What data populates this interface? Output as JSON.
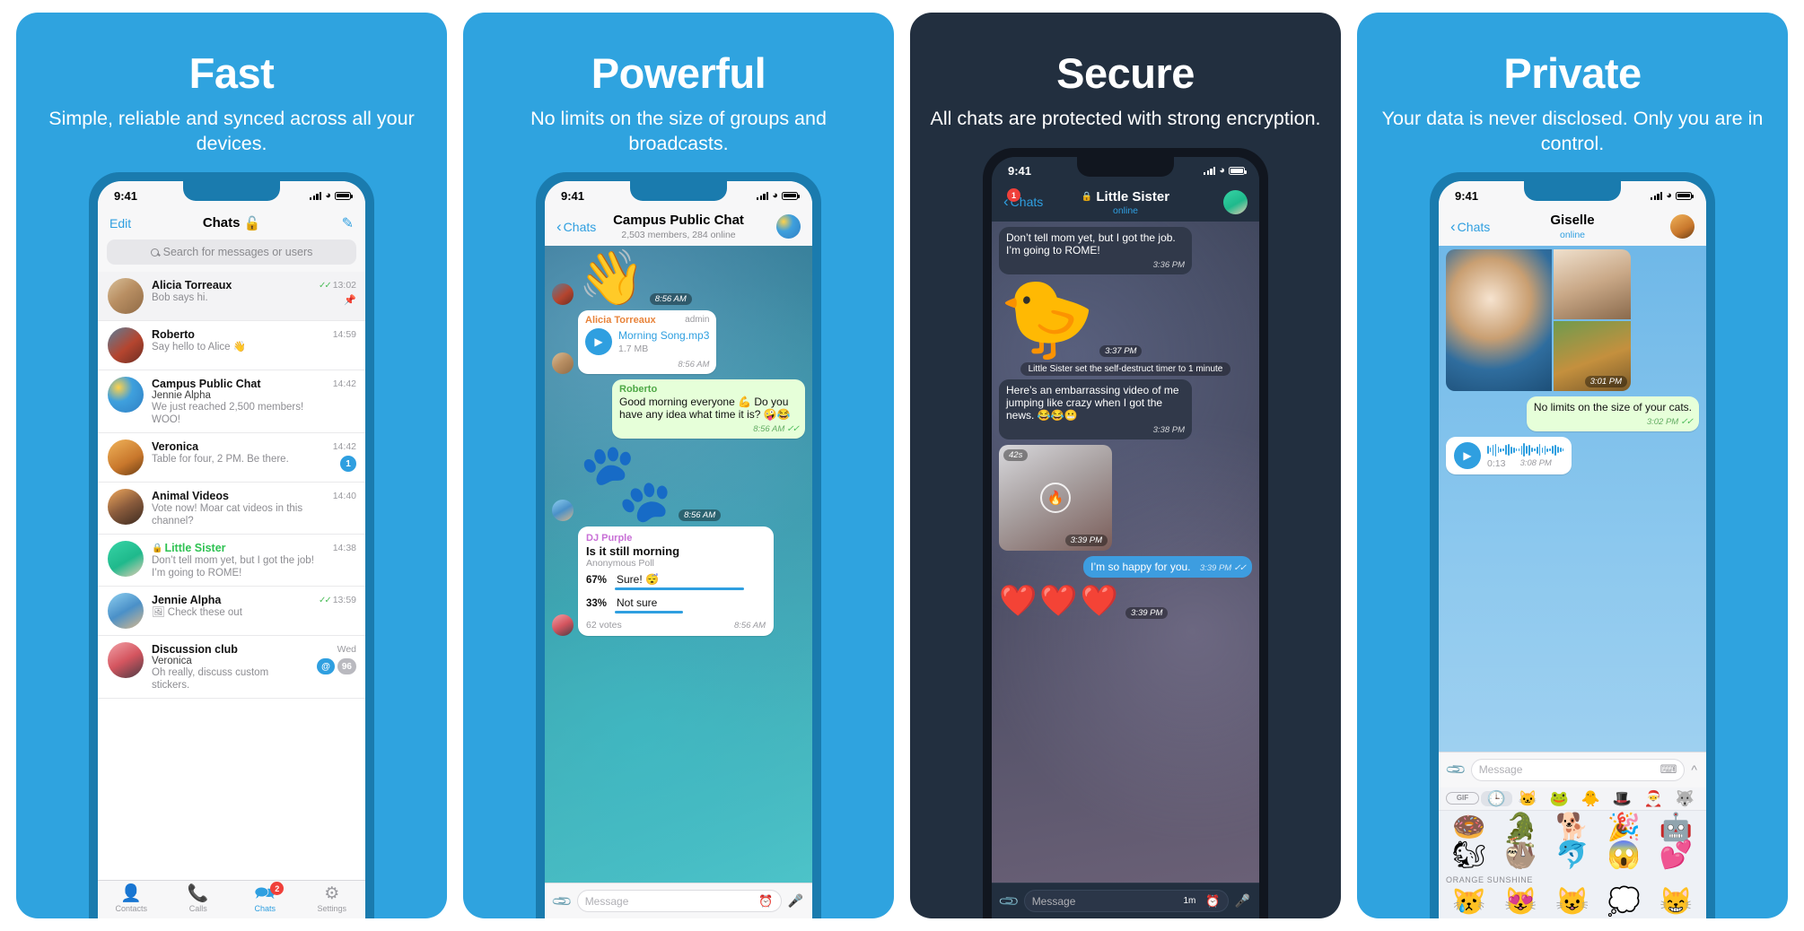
{
  "panels": [
    {
      "id": "fast",
      "headline": "Fast",
      "subhead": "Simple, reliable and synced across all your devices.",
      "status": {
        "time": "9:41"
      },
      "nav": {
        "left": "Edit",
        "title": "Chats",
        "lock_icon": "unlock-icon",
        "compose_icon": "compose-icon"
      },
      "search": {
        "placeholder": "Search for messages or users",
        "icon": "search-icon"
      },
      "chats": [
        {
          "name": "Alicia Torreaux",
          "sender": "",
          "message": "Bob says hi.",
          "time": "13:02",
          "ticks": "✓✓",
          "badge": "",
          "pin": "pin-icon",
          "secure": false,
          "unread": true
        },
        {
          "name": "Roberto",
          "sender": "",
          "message": "Say hello to Alice 👋",
          "time": "14:59",
          "ticks": "",
          "badge": "",
          "pin": "",
          "secure": false,
          "unread": false
        },
        {
          "name": "Campus Public Chat",
          "sender": "Jennie Alpha",
          "message": "We just reached 2,500 members! WOO!",
          "time": "14:42",
          "ticks": "",
          "badge": "",
          "pin": "",
          "secure": false,
          "unread": false
        },
        {
          "name": "Veronica",
          "sender": "",
          "message": "Table for four, 2 PM. Be there.",
          "time": "14:42",
          "ticks": "",
          "badge": "1",
          "pin": "",
          "secure": false,
          "unread": false
        },
        {
          "name": "Animal Videos",
          "sender": "",
          "message": "Vote now! Moar cat videos in this channel?",
          "time": "14:40",
          "ticks": "",
          "badge": "",
          "pin": "",
          "secure": false,
          "unread": false
        },
        {
          "name": "Little Sister",
          "sender": "",
          "message": "Don’t tell mom yet, but I got the job! I’m going to ROME!",
          "time": "14:38",
          "ticks": "",
          "badge": "",
          "pin": "",
          "secure": true,
          "unread": false
        },
        {
          "name": "Jennie Alpha",
          "sender": "",
          "message": "🖼 Check these out",
          "time": "13:59",
          "ticks": "✓✓",
          "badge": "",
          "pin": "",
          "secure": false,
          "unread": false
        },
        {
          "name": "Discussion club",
          "sender": "Veronica",
          "message": "Oh really, discuss custom stickers.",
          "time": "Wed",
          "ticks": "",
          "badge": "96",
          "mention": "@",
          "pin": "",
          "secure": false,
          "unread": false
        }
      ],
      "tabs": [
        {
          "label": "Contacts",
          "icon": "contacts-icon",
          "active": false,
          "badge": ""
        },
        {
          "label": "Calls",
          "icon": "phone-icon",
          "active": false,
          "badge": ""
        },
        {
          "label": "Chats",
          "icon": "chat-bubbles-icon",
          "active": true,
          "badge": "2"
        },
        {
          "label": "Settings",
          "icon": "gear-icon",
          "active": false,
          "badge": ""
        }
      ]
    },
    {
      "id": "powerful",
      "headline": "Powerful",
      "subhead": "No limits on the size of groups and broadcasts.",
      "status": {
        "time": "9:41"
      },
      "nav": {
        "left": "Chats",
        "title": "Campus Public Chat",
        "subtitle": "2,503 members, 284 online",
        "avatar": "group-avatar"
      },
      "messages": [
        {
          "kind": "sticker",
          "glyph": "👋",
          "time": "8:56 AM",
          "avatar": "ph2"
        },
        {
          "kind": "file",
          "sender": "Alicia Torreaux",
          "sender_color": "orange",
          "admin": "admin",
          "filename": "Morning Song.mp3",
          "filesize": "1.7 MB",
          "time": "8:56 AM",
          "avatar": "ph1"
        },
        {
          "kind": "text",
          "sender": "Roberto",
          "sender_color": "green",
          "text": "Good morning everyone 💪 Do you have any idea what time it is? 🤪😂",
          "time": "8:56 AM",
          "ticks": "✓✓",
          "out": true
        },
        {
          "kind": "sticker",
          "glyph": "🐾",
          "time": "8:56 AM",
          "avatar": "ph7"
        },
        {
          "kind": "poll",
          "sender": "DJ Purple",
          "sender_color": "purple",
          "question": "Is it still morning",
          "subtitle": "Anonymous Poll",
          "options": [
            {
              "pct": "67%",
              "label": "Sure! 😴",
              "value": 67
            },
            {
              "pct": "33%",
              "label": "Not sure",
              "value": 33
            }
          ],
          "votes": "62 votes",
          "time": "8:56 AM",
          "avatar": "ph8"
        }
      ],
      "composer": {
        "clip_icon": "attach-icon",
        "placeholder": "Message",
        "timer_icon": "schedule-icon",
        "mic_icon": "microphone-icon"
      }
    },
    {
      "id": "secure",
      "headline": "Secure",
      "subhead": "All chats are protected with strong encryption.",
      "status": {
        "time": "9:41"
      },
      "nav": {
        "left": "Chats",
        "left_badge": "1",
        "title": "Little Sister",
        "lock_icon": "lock-icon",
        "subtitle": "online",
        "avatar": "ph6"
      },
      "messages": [
        {
          "kind": "text",
          "text": "Don’t tell mom yet, but I got the job. I’m going to ROME!",
          "time": "3:36 PM",
          "out": false
        },
        {
          "kind": "sticker",
          "glyph": "🐤",
          "time": "3:37 PM"
        },
        {
          "kind": "service",
          "text": "Little Sister set the self-destruct timer to 1 minute"
        },
        {
          "kind": "text",
          "text": "Here’s an embarrassing video of me jumping like crazy when I got the news. 😂😂😬",
          "time": "3:38 PM",
          "out": false
        },
        {
          "kind": "video",
          "duration": "42s",
          "time": "3:39 PM",
          "burn_icon": "flame-icon"
        },
        {
          "kind": "text",
          "text": "I’m so happy for you.",
          "time": "3:39 PM",
          "ticks": "✓✓",
          "out": true
        },
        {
          "kind": "sticker-row",
          "glyph": "❤️❤️❤️",
          "time": "3:39 PM"
        }
      ],
      "composer": {
        "clip_icon": "attach-icon",
        "placeholder": "Message",
        "timer_value": "1m",
        "timer_icon": "self-destruct-timer-icon",
        "mic_icon": "microphone-icon"
      }
    },
    {
      "id": "private",
      "headline": "Private",
      "subhead": "Your data is never disclosed. Only you are in control.",
      "status": {
        "time": "9:41"
      },
      "nav": {
        "left": "Chats",
        "title": "Giselle",
        "subtitle": "online",
        "avatar": "ph5"
      },
      "messages": [
        {
          "kind": "album",
          "time": "3:01 PM"
        },
        {
          "kind": "text",
          "text": "No limits on the size of your cats.",
          "time": "3:02 PM",
          "ticks": "✓✓",
          "out": true
        },
        {
          "kind": "voice",
          "duration": "0:13",
          "time": "3:08 PM",
          "play_icon": "play-icon"
        }
      ],
      "composer": {
        "clip_icon": "attach-icon",
        "placeholder": "Message",
        "keyboard_icon": "keyboard-icon",
        "expand_icon": "chevron-up-icon"
      },
      "sticker_panel": {
        "tabs": [
          "GIF",
          "🕒",
          "🐱",
          "🐸",
          "🐥",
          "🎩",
          "🎅",
          "🐺"
        ],
        "selected_tab_index": 1,
        "rows": [
          [
            "🍩",
            "🐊",
            "🐕",
            "🎉",
            "🤖"
          ],
          [
            "🐿",
            "🦥",
            "🐬",
            "😱",
            "💕"
          ]
        ],
        "section_label": "ORANGE SUNSHINE",
        "section_rows": [
          [
            "😿",
            "😻",
            "😺",
            "💭",
            "😸"
          ]
        ]
      }
    }
  ],
  "colors": {
    "brand_blue": "#2fa3df",
    "dark_panel": "#222f3f",
    "accent_blue": "#2f9fe0",
    "green": "#2ec252",
    "red_badge": "#f0403a"
  }
}
